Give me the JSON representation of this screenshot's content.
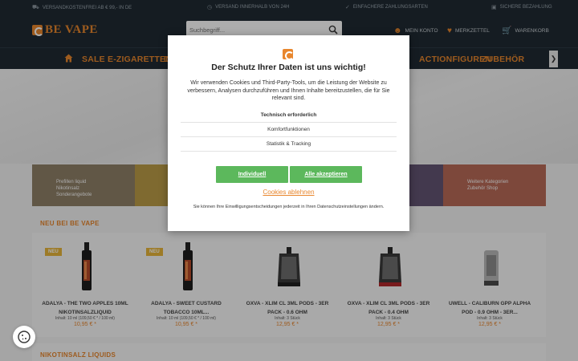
{
  "topbar": {
    "items": [
      {
        "icon": "truck-icon",
        "text": "VERSANDKOSTENFREI AB € 99,- IN DE"
      },
      {
        "icon": "clock-icon",
        "text": "VERSAND INNERHALB VON 24H"
      },
      {
        "icon": "check-icon",
        "text": "EINFACHERE ZAHLUNGSARTEN"
      },
      {
        "icon": "shield-icon",
        "text": "SICHERE BEZAHLUNG"
      }
    ]
  },
  "header": {
    "logo_text": "BE VAPE",
    "search_placeholder": "Suchbegriff...",
    "account_label": "MEIN KONTO",
    "wishlist_label": "MERKZETTEL",
    "cart_label": "WARENKORB"
  },
  "nav": {
    "items": [
      "SALE",
      "E-ZIGARETTEN",
      "D",
      "ACTIONFIGUREN",
      "ZUBEHÖR"
    ]
  },
  "tiles": {
    "texts": [
      "Prefillen liquid Nikotinsalz Sonderangebote",
      "",
      "",
      "",
      "Weitere Kategorien Zubehör Shop"
    ],
    "colors": [
      "#8a7a60",
      "#b7973e",
      "#9a7d4a",
      "#5b4b6b",
      "#b5634f"
    ]
  },
  "new_section": {
    "title": "NEU BEI BE VAPE",
    "badge": "NEU",
    "products": [
      {
        "name": "ADALYA - THE TWO APPLES 10ML NIKOTINSALZLIQUID",
        "info": "Inhalt: 10 ml (109,50 € * / 100 ml)",
        "price": "10,95 € *",
        "badge": true,
        "type": "bottle"
      },
      {
        "name": "ADALYA - SWEET CUSTARD TOBACCO 10ML...",
        "info": "Inhalt: 10 ml (109,50 € * / 100 ml)",
        "price": "10,95 € *",
        "badge": true,
        "type": "bottle"
      },
      {
        "name": "OXVA - XLIM CL 3ML PODS - 3ER PACK - 0.6 OHM",
        "info": "Inhalt: 3 Stück",
        "price": "12,95 € *",
        "badge": false,
        "type": "pod"
      },
      {
        "name": "OXVA - XLIM CL 3ML PODS - 3ER PACK - 0.4 OHM",
        "info": "Inhalt: 3 Stück",
        "price": "12,95 € *",
        "badge": false,
        "type": "pod-red"
      },
      {
        "name": "UWELL - CALIBURN GPP ALPHA POD - 0.9 OHM - 3ER...",
        "info": "Inhalt: 3 Stück",
        "price": "12,95 € *",
        "badge": false,
        "type": "pod-clear"
      }
    ]
  },
  "nik_section": {
    "title": "NIKOTINSALZ LIQUIDS"
  },
  "cookie_modal": {
    "title": "Der Schutz Ihrer Daten ist uns wichtig!",
    "text": "Wir verwenden Cookies und Third-Party-Tools, um die Leistung der Website zu verbessern, Analysen durchzuführen und Ihnen Inhalte bereitzustellen, die für Sie relevant sind.",
    "options": [
      "Technisch erforderlich",
      "Komfortfunktionen",
      "Statistik & Tracking"
    ],
    "individual_label": "Individuell",
    "accept_all_label": "Alle akzeptieren",
    "reject_label": "Cookies ablehnen",
    "note": "Sie können Ihre Einwilligungsentscheidungen jederzeit in Ihren Datenschutzeinstellungen ändern."
  }
}
